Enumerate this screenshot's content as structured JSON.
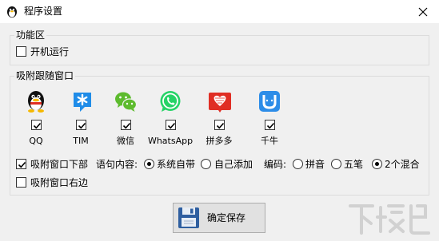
{
  "window": {
    "title": "程序设置",
    "icon": "penguin-icon",
    "close_icon": "close-icon"
  },
  "function_group": {
    "title": "功能区",
    "autostart_label": "开机运行",
    "autostart_checked": false
  },
  "attach_group": {
    "title": "吸附跟随窗口",
    "apps": [
      {
        "name": "QQ",
        "icon": "qq-penguin-icon",
        "checked": true
      },
      {
        "name": "TIM",
        "icon": "tim-icon",
        "checked": true
      },
      {
        "name": "微信",
        "icon": "wechat-icon",
        "checked": true
      },
      {
        "name": "WhatsApp",
        "icon": "whatsapp-icon",
        "checked": true
      },
      {
        "name": "拼多多",
        "icon": "pinduoduo-icon",
        "checked": true
      },
      {
        "name": "千牛",
        "icon": "qianniu-icon",
        "checked": true
      }
    ],
    "attach_bottom_label": "吸附窗口下部",
    "attach_bottom_checked": true,
    "attach_right_label": "吸附窗口右边",
    "attach_right_checked": false,
    "content_label": "语句内容:",
    "content_options": [
      {
        "label": "系统自带",
        "selected": true
      },
      {
        "label": "自己添加",
        "selected": false
      }
    ],
    "encoding_label": "编码:",
    "encoding_options": [
      {
        "label": "拼音",
        "selected": false
      },
      {
        "label": "五笔",
        "selected": false
      },
      {
        "label": "2个混合",
        "selected": true
      }
    ]
  },
  "save_button": {
    "label": "确定保存",
    "icon": "floppy-disk-icon"
  },
  "colors": {
    "window_bg": "#f0f0f0",
    "qq_yellow": "#f5b800",
    "tim_blue": "#1f8ce8",
    "wechat_green": "#5dbb2e",
    "whatsapp_green": "#25d366",
    "pdd_red": "#e02e24",
    "qianniu_blue": "#2d8de8"
  },
  "watermark": {
    "text": "下载吧",
    "icon": "watermark-logo-icon"
  }
}
